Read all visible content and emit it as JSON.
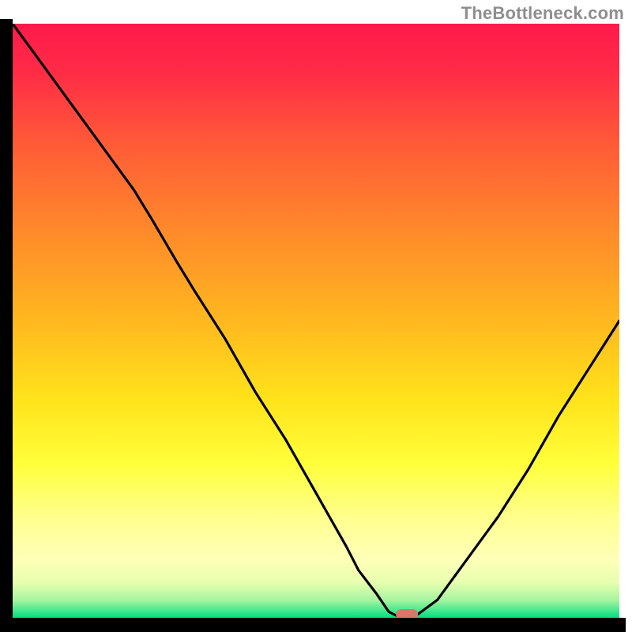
{
  "attribution": "TheBottleneck.com",
  "chart_data": {
    "type": "line",
    "title": "",
    "xlabel": "",
    "ylabel": "",
    "xlim": [
      0,
      100
    ],
    "ylim": [
      0,
      100
    ],
    "x": [
      0,
      5,
      10,
      15,
      20,
      23,
      27,
      30,
      35,
      40,
      45,
      50,
      55,
      57,
      60,
      62,
      64,
      66,
      70,
      75,
      80,
      85,
      90,
      95,
      100
    ],
    "values": [
      100,
      93,
      86,
      79,
      72,
      67,
      60,
      55,
      47,
      38,
      30,
      21,
      12,
      8,
      4,
      1,
      0,
      0,
      3,
      10,
      17,
      25,
      34,
      42,
      50
    ],
    "series": [
      {
        "name": "bottleneck-curve",
        "x": [
          0,
          5,
          10,
          15,
          20,
          23,
          27,
          30,
          35,
          40,
          45,
          50,
          55,
          57,
          60,
          62,
          64,
          66,
          70,
          75,
          80,
          85,
          90,
          95,
          100
        ],
        "values": [
          100,
          93,
          86,
          79,
          72,
          67,
          60,
          55,
          47,
          38,
          30,
          21,
          12,
          8,
          4,
          1,
          0,
          0,
          3,
          10,
          17,
          25,
          34,
          42,
          50
        ]
      }
    ],
    "marker": {
      "x": 65,
      "y": 0
    },
    "background_bands": [
      {
        "y0": 100,
        "y1": 70,
        "color_top": "#ff1a4b",
        "color_bottom": "#ff6a2f"
      },
      {
        "y0": 70,
        "y1": 40,
        "color_top": "#ff6a2f",
        "color_bottom": "#ffd61f"
      },
      {
        "y0": 40,
        "y1": 10,
        "color_top": "#ffd61f",
        "color_bottom": "#ffff88"
      },
      {
        "y0": 10,
        "y1": 0,
        "color_top": "#ffff88",
        "color_bottom": "#00e082"
      }
    ],
    "colors": {
      "curve": "#000000",
      "marker": "#e0746a",
      "axis": "#000000"
    }
  }
}
